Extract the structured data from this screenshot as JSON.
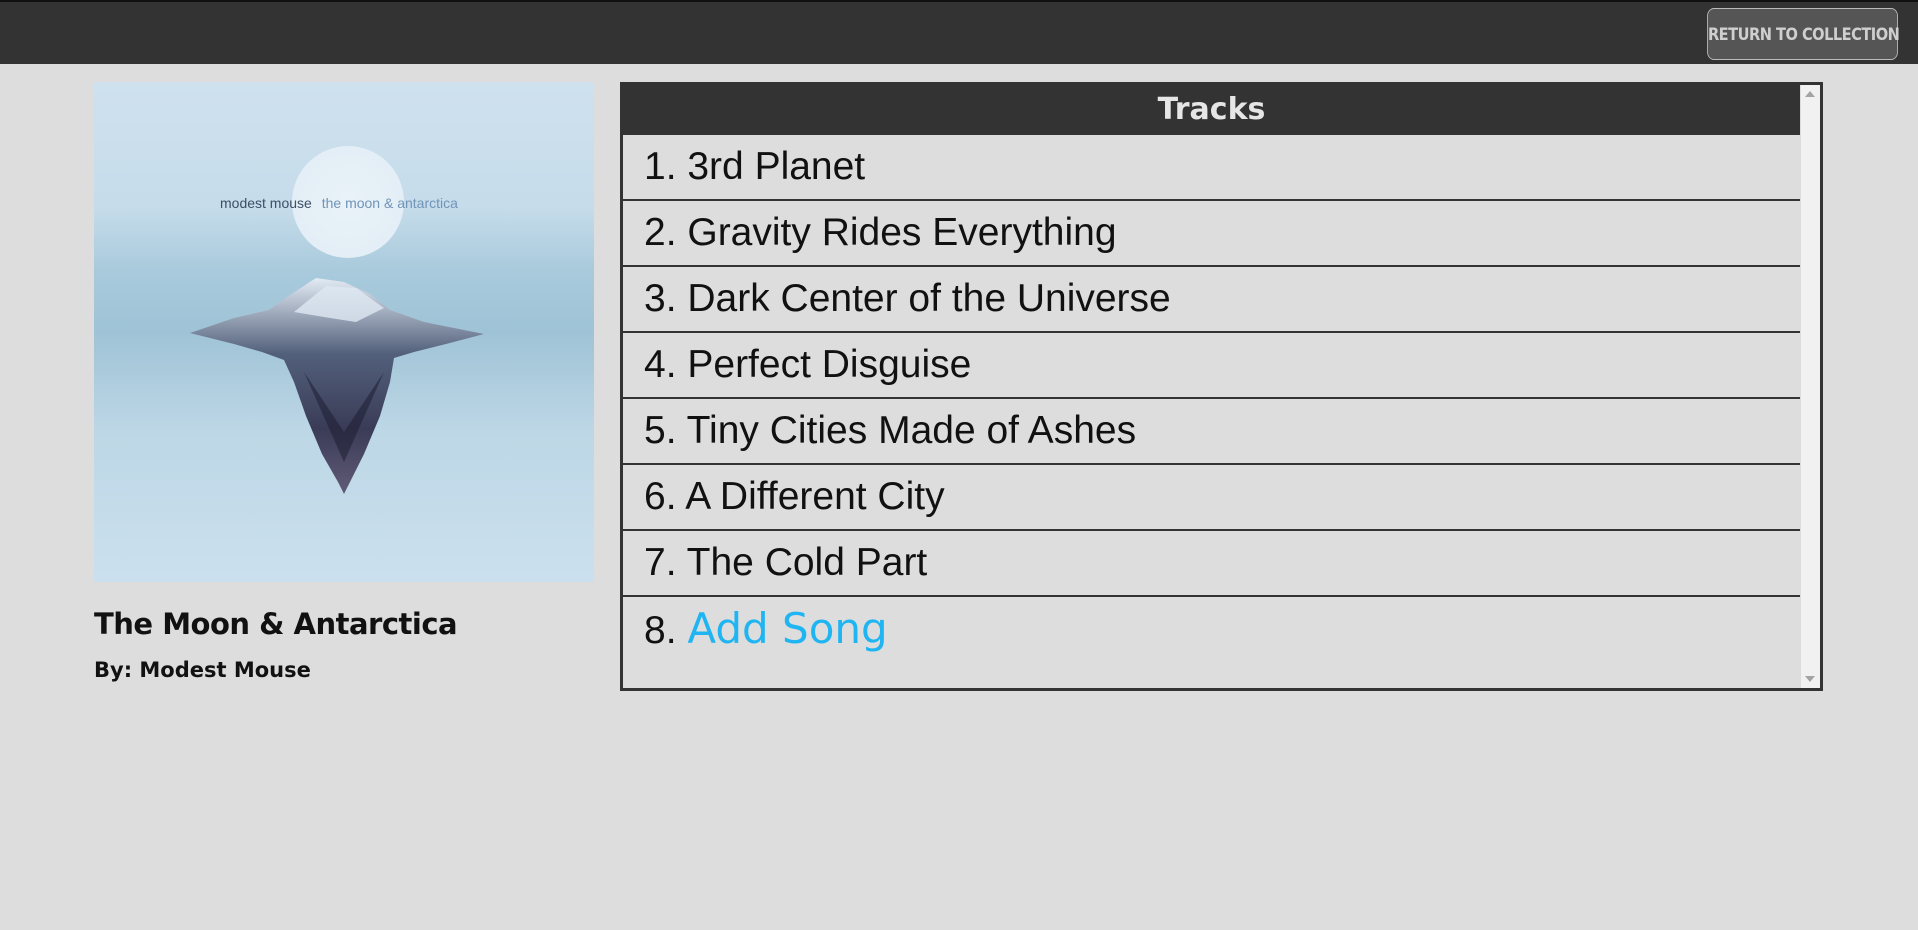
{
  "topbar": {
    "return_label": "RETURN TO COLLECTION"
  },
  "album": {
    "cover_band_text": "modest mouse",
    "cover_album_text": "the moon & antarctica",
    "title": "The Moon & Antarctica",
    "artist": "By: Modest Mouse"
  },
  "tracks": {
    "header": "Tracks",
    "items": [
      {
        "label": "1. 3rd Planet"
      },
      {
        "label": "2. Gravity Rides Everything"
      },
      {
        "label": "3. Dark Center of the Universe"
      },
      {
        "label": "4. Perfect Disguise"
      },
      {
        "label": "5. Tiny Cities Made of Ashes"
      },
      {
        "label": "6. A Different City"
      },
      {
        "label": "7. The Cold Part"
      }
    ],
    "add_number": "8.",
    "add_label": "Add Song"
  },
  "colors": {
    "topbar": "#333333",
    "background": "#dddddd",
    "add_link": "#1fb5f2"
  }
}
